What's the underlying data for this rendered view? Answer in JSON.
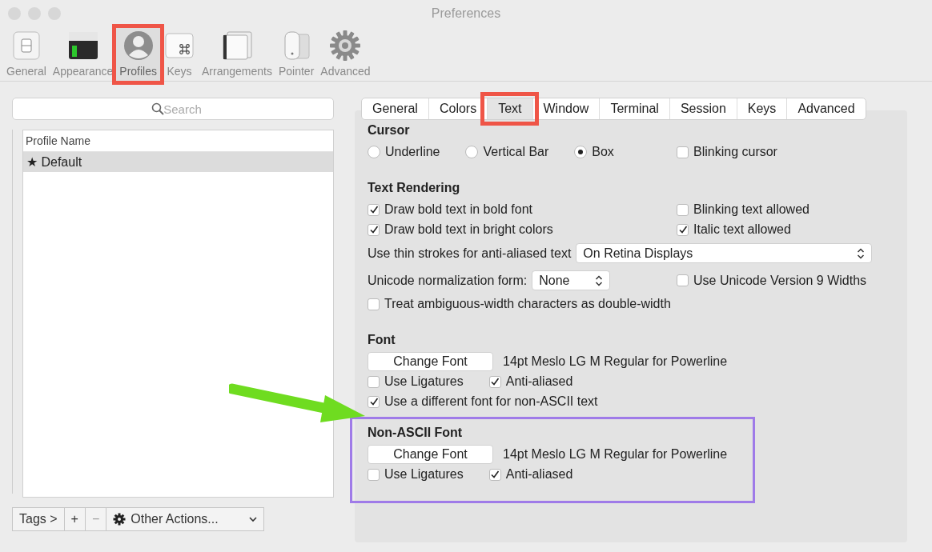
{
  "window": {
    "title": "Preferences"
  },
  "toolbar": [
    {
      "label": "General",
      "selected": false,
      "highlighted": false
    },
    {
      "label": "Appearance",
      "selected": false,
      "highlighted": false
    },
    {
      "label": "Profiles",
      "selected": true,
      "highlighted": true
    },
    {
      "label": "Keys",
      "selected": false,
      "highlighted": false
    },
    {
      "label": "Arrangements",
      "selected": false,
      "highlighted": false
    },
    {
      "label": "Pointer",
      "selected": false,
      "highlighted": false
    },
    {
      "label": "Advanced",
      "selected": false,
      "highlighted": false
    }
  ],
  "sidebar": {
    "search": {
      "placeholder": "Search"
    },
    "column": "Profile Name",
    "profiles": [
      {
        "name": "★ Default",
        "selected": true
      }
    ],
    "buttons": [
      {
        "kind": "button",
        "label": "Tags >",
        "disabled": false
      },
      {
        "kind": "button",
        "label": "+",
        "disabled": false
      },
      {
        "kind": "button",
        "label": "−",
        "disabled": true
      },
      {
        "kind": "menu",
        "label": "Other Actions...",
        "disabled": false
      }
    ]
  },
  "tabs": [
    {
      "label": "General",
      "selected": false,
      "highlighted": false
    },
    {
      "label": "Colors",
      "selected": false,
      "highlighted": false
    },
    {
      "label": "Text",
      "selected": true,
      "highlighted": true
    },
    {
      "label": "Window",
      "selected": false,
      "highlighted": false
    },
    {
      "label": "Terminal",
      "selected": false,
      "highlighted": false
    },
    {
      "label": "Session",
      "selected": false,
      "highlighted": false
    },
    {
      "label": "Keys",
      "selected": false,
      "highlighted": false
    },
    {
      "label": "Advanced",
      "selected": false,
      "highlighted": false
    }
  ],
  "sections": [
    {
      "title": "Cursor",
      "highlighted": false,
      "rows": [
        {
          "left": [
            {
              "kind": "radio",
              "label": "Underline",
              "selected": false
            },
            {
              "kind": "radio",
              "label": "Vertical Bar",
              "selected": false
            },
            {
              "kind": "radio",
              "label": "Box",
              "selected": true
            }
          ],
          "right": [
            {
              "kind": "checkbox",
              "label": "Blinking cursor",
              "checked": false
            }
          ]
        }
      ]
    },
    {
      "title": "Text Rendering",
      "highlighted": false,
      "rows": [
        {
          "left": [
            {
              "kind": "checkbox",
              "label": "Draw bold text in bold font",
              "checked": true
            }
          ],
          "right": [
            {
              "kind": "checkbox",
              "label": "Blinking text allowed",
              "checked": false
            }
          ]
        },
        {
          "left": [
            {
              "kind": "checkbox",
              "label": "Draw bold text in bright colors",
              "checked": true
            }
          ],
          "right": [
            {
              "kind": "checkbox",
              "label": "Italic text allowed",
              "checked": true
            }
          ]
        },
        {
          "left": [
            {
              "kind": "text",
              "label": "Use thin strokes for anti-aliased text"
            },
            {
              "kind": "select",
              "label": "On Retina Displays",
              "wide": true
            }
          ]
        },
        {
          "left": [
            {
              "kind": "text",
              "label": "Unicode normalization form:"
            },
            {
              "kind": "select",
              "label": "None",
              "wide": false
            }
          ],
          "right": [
            {
              "kind": "checkbox",
              "label": "Use Unicode Version 9 Widths",
              "checked": false
            }
          ]
        },
        {
          "left": [
            {
              "kind": "checkbox",
              "label": "Treat ambiguous-width characters as double-width",
              "checked": false
            }
          ]
        }
      ]
    },
    {
      "title": "Font",
      "highlighted": false,
      "rows": [
        {
          "left": [
            {
              "kind": "button",
              "label": "Change Font"
            },
            {
              "kind": "text",
              "label": "14pt Meslo LG M Regular for Powerline"
            }
          ]
        },
        {
          "left": [
            {
              "kind": "checkbox",
              "label": "Use Ligatures",
              "checked": false
            },
            {
              "kind": "checkbox",
              "label": "Anti-aliased",
              "checked": true
            }
          ]
        },
        {
          "left": [
            {
              "kind": "checkbox",
              "label": "Use a different font for non-ASCII text",
              "checked": true
            }
          ]
        }
      ]
    },
    {
      "title": "Non-ASCII Font",
      "highlighted": true,
      "rows": [
        {
          "left": [
            {
              "kind": "button",
              "label": "Change Font"
            },
            {
              "kind": "text",
              "label": "14pt Meslo LG M Regular for Powerline"
            }
          ]
        },
        {
          "left": [
            {
              "kind": "checkbox",
              "label": "Use Ligatures",
              "checked": false
            },
            {
              "kind": "checkbox",
              "label": "Anti-aliased",
              "checked": true
            }
          ]
        }
      ]
    }
  ],
  "annotation": {
    "arrow": true
  }
}
